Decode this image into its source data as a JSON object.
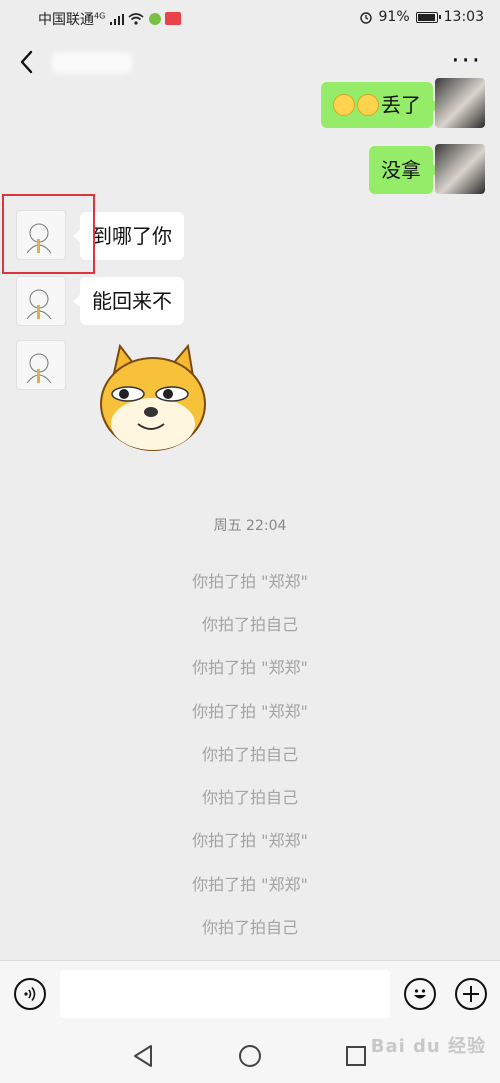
{
  "status_bar": {
    "carrier": "中国联通",
    "network": "4G",
    "battery": "91%",
    "time": "13:03"
  },
  "header": {
    "back_icon": "chevron-left-icon",
    "more_icon": "more-dots-icon",
    "more_label": "···"
  },
  "messages": [
    {
      "side": "right",
      "text": "丢了",
      "prefix_emojis": 2
    },
    {
      "side": "right",
      "text": "没拿"
    },
    {
      "side": "left",
      "text": "到哪了你"
    },
    {
      "side": "left",
      "text": "能回来不"
    },
    {
      "side": "left",
      "type": "sticker",
      "sticker": "doge-dog-sticker"
    }
  ],
  "timestamp": "周五 22:04",
  "system_lines": [
    "你拍了拍 \"郑郑\"",
    "你拍了拍自己",
    "你拍了拍 \"郑郑\"",
    "你拍了拍 \"郑郑\"",
    "你拍了拍自己",
    "你拍了拍自己",
    "你拍了拍 \"郑郑\"",
    "你拍了拍 \"郑郑\"",
    "你拍了拍自己"
  ],
  "input_bar": {
    "voice_icon": "voice-icon",
    "emoji_icon": "smiley-icon",
    "plus_icon": "plus-icon",
    "placeholder": ""
  },
  "nav_bar": {
    "back": "triangle-back-icon",
    "home": "circle-home-icon",
    "recents": "square-recents-icon"
  },
  "watermark": "Bai du 经验"
}
